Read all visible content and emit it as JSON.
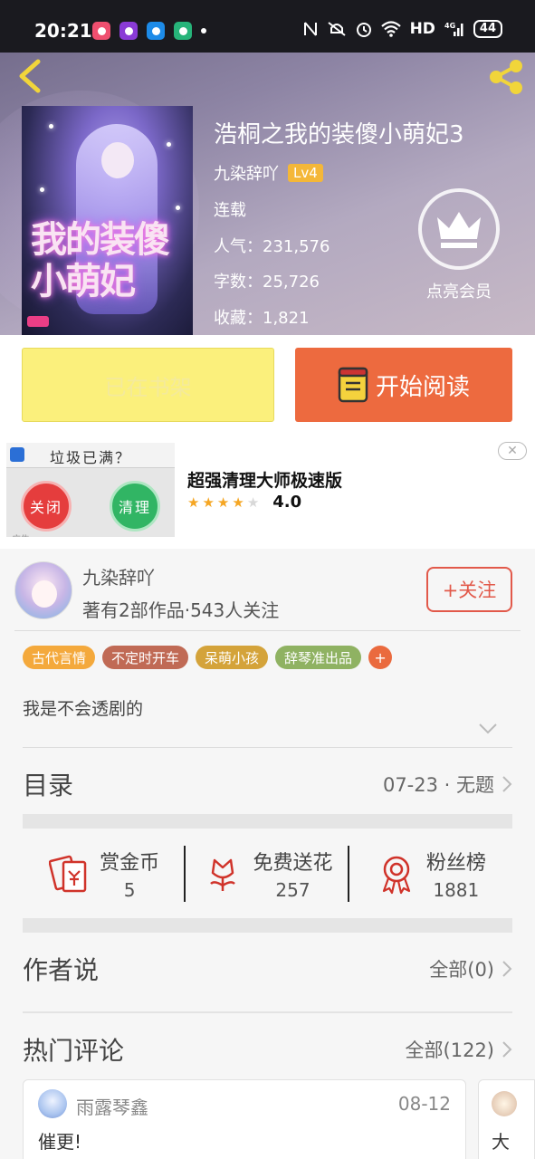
{
  "status_bar": {
    "time": "20:21",
    "network": "HD",
    "signal_label": "4G",
    "battery": "44",
    "app_icon_colors": [
      "#ef4f6f",
      "#8a3bd6",
      "#1d8be8",
      "#27b47a"
    ]
  },
  "header": {
    "back_icon": "chevron-left-icon",
    "share_icon": "share-icon"
  },
  "book": {
    "title": "浩桐之我的装傻小萌妃3",
    "cover_text": "我的装傻小萌妃",
    "author": "九染辞吖",
    "level": "Lv4",
    "status": "连载",
    "popularity": "人气：231,576",
    "word_count": "字数：25,726",
    "favorites": "收藏：1,821",
    "vip_label": "点亮会员"
  },
  "actions": {
    "shelf_label": "已在书架",
    "read_label": "开始阅读"
  },
  "ad": {
    "image_question": "垃圾已满？",
    "image_close": "关闭",
    "image_clean": "清理",
    "image_tag": "广告",
    "title": "超强清理大师极速版",
    "rating": "4.0",
    "rating_value": 4,
    "close_icon": "close-icon"
  },
  "author_card": {
    "name": "九染辞吖",
    "stats": "著有2部作品·543人关注",
    "follow_label": "+关注"
  },
  "tags": [
    {
      "label": "古代言情",
      "color": "#f4a93c"
    },
    {
      "label": "不定时开车",
      "color": "#c06a55"
    },
    {
      "label": "呆萌小孩",
      "color": "#d4a33a"
    },
    {
      "label": "辞琴准出品",
      "color": "#8fb262"
    }
  ],
  "tags_more": "+",
  "intro": "我是不会透剧的",
  "catalog": {
    "title": "目录",
    "latest": "07-23 · 无题"
  },
  "rewards": [
    {
      "label": "赏金币",
      "value": "5",
      "icon": "red-envelope-icon"
    },
    {
      "label": "免费送花",
      "value": "257",
      "icon": "flower-icon"
    },
    {
      "label": "粉丝榜",
      "value": "1881",
      "icon": "medal-icon"
    }
  ],
  "author_says": {
    "title": "作者说",
    "all": "全部(0)"
  },
  "hot_comments": {
    "title": "热门评论",
    "all": "全部(122)",
    "items": [
      {
        "user": "雨露琴鑫",
        "date": "08-12",
        "text": "催更!"
      },
      {
        "user": "",
        "date": "",
        "text": "大"
      }
    ]
  }
}
